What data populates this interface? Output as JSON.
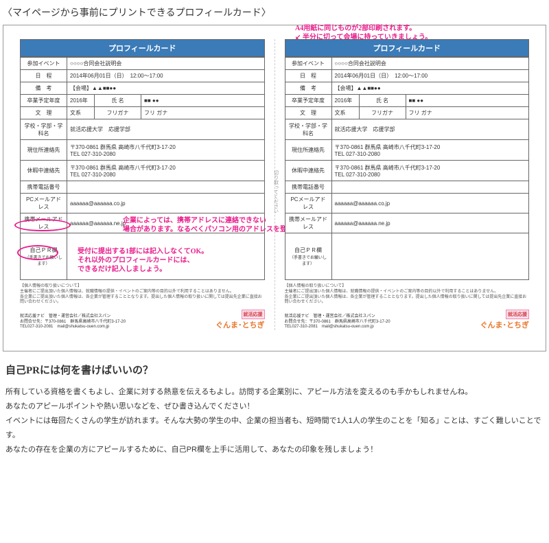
{
  "page_title": "〈マイページから事前にプリントできるプロフィールカード〉",
  "annotation_top": "A4用紙に同じものが2部印刷されます。\n↙ 半分に切って会場に持っていきましょう。",
  "annotation_email": "企業によっては、携帯アドレスに連絡できない\n場合があります。なるべくパソコン用のアドレスを登録しましょう。",
  "annotation_pr": "受付に提出する1部には記入しなくてOK。\nそれ以外のプロフィールカードには、\nできるだけ記入しましょう。",
  "divider_label": "切り取ってください",
  "card": {
    "header": "プロフィールカード",
    "rows": {
      "event_label": "参加イベント",
      "event_value": "○○○○合同会社説明会",
      "date_label": "日　程",
      "date_value": "2014年06月01日（日）　12:00～17:00",
      "note_label": "備　考",
      "note_value": "【会場】▲▲■■●●",
      "grad_label": "卒業予定年度",
      "grad_value": "2016年",
      "name_label": "氏 名",
      "name_value": "■■ ●●",
      "major_label": "文　理",
      "major_value": "文系",
      "kana_label": "フリガナ",
      "kana_value": "フリ ガナ",
      "school_label": "学校・学部・学科名",
      "school_value": "就活応援大学　応援学部",
      "addr_label": "現住所連絡先",
      "addr_value1": "〒370-0861 群馬県 高崎市八千代町3-17-20",
      "addr_value2": "TEL 027-310-2080",
      "vac_label": "休暇中連絡先",
      "vac_value1": "〒370-0861 群馬県 高崎市八千代町3-17-20",
      "vac_value2": "TEL 027-310-2080",
      "mobile_label": "携帯電話番号",
      "mobile_value": "",
      "pcmail_label": "PCメールアドレス",
      "pcmail_value": "aaaaaa@aaaaaa.co.jp",
      "mbmail_label": "携帯メールアドレス",
      "mbmail_value": "aaaaaa@aaaaaa.ne.jp",
      "pr_label": "自己ＰＲ欄",
      "pr_sub": "（手書きでお願いします）"
    },
    "disclaimer_title": "【個人情報の取り扱いについて】",
    "disclaimer_body": "主催者にご提出頂いた個人情報は、就職情報の提供・イベントのご案内等の目的以外で利用することはありません。\n各企業にご提出頂いた個人情報は、各企業が管理することとなります。提出した個人情報の取り扱いに関しては提出先企業に直接お問い合わせください。",
    "footer1": "就活応援ナビ　管理・運営会社／株式会社スパン",
    "footer2": "お問合せ先：〒370-0861　群馬県高崎市八千代町3-17-20",
    "footer3": "TEL027-310-2081　mail@shukatsu-ouen.com.jp",
    "logo_top": "就活応援",
    "logo_main": "ぐんま･とちぎ"
  },
  "bottom": {
    "title": "自己PRには何を書けばいいの？",
    "p1": "所有している資格を書くもよし、企業に対する熱意を伝えるもよし。訪問する企業別に、アピール方法を変えるのも手かもしれませんね。",
    "p2": "あなたのアピールポイントや熱い思いなどを、ぜひ書き込んでください！",
    "p3": "イベントには毎回たくさんの学生が訪れます。そんな大勢の学生の中、企業の担当者も、短時間で1人1人の学生のことを「知る」ことは、すごく難しいことです。",
    "p4": "あなたの存在を企業の方にアピールするために、自己PR欄を上手に活用して、あなたの印象を残しましょう！"
  }
}
